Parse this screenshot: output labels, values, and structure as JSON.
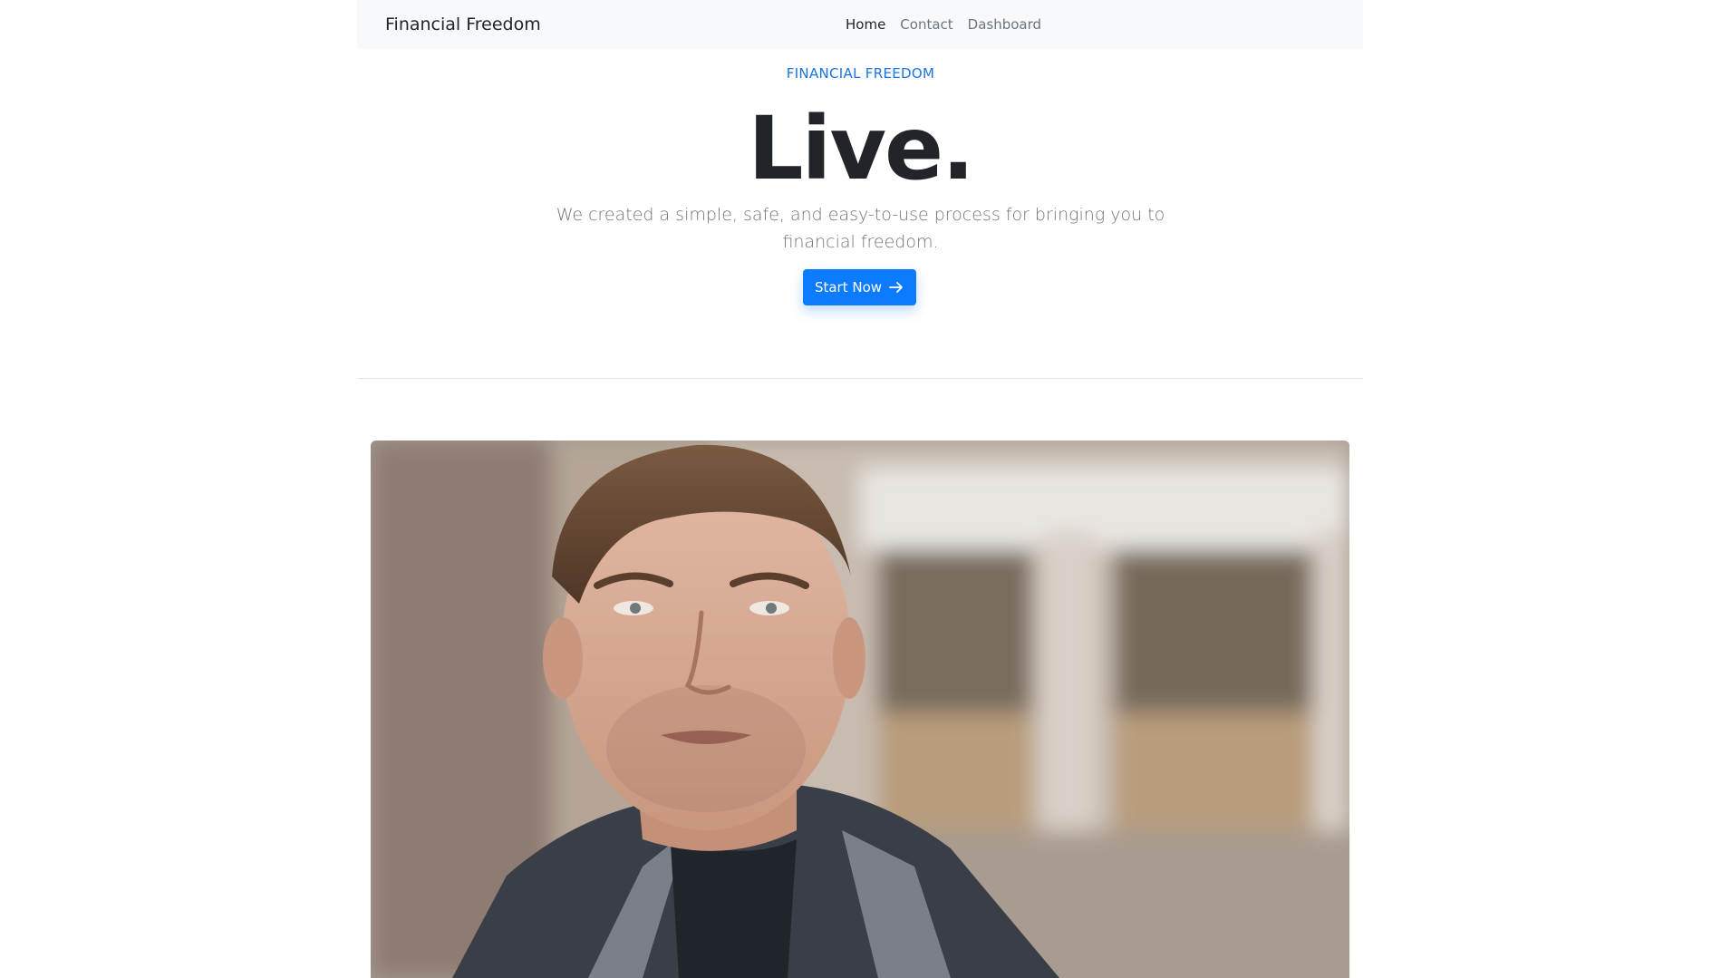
{
  "navbar": {
    "brand": "Financial Freedom",
    "links": [
      {
        "label": "Home",
        "active": true
      },
      {
        "label": "Contact",
        "active": false
      },
      {
        "label": "Dashboard",
        "active": false
      }
    ]
  },
  "hero": {
    "eyebrow": "FINANCIAL FREEDOM",
    "title": "Live.",
    "subtitle": "We created a simple, safe, and easy-to-use process for bringing you to financial freedom.",
    "cta_label": "Start Now",
    "cta_icon": "arrow-right-icon"
  },
  "media": {
    "icon": "video-frame-man-talking"
  },
  "colors": {
    "accent": "#0d7bff",
    "eyebrow": "#1a73e8",
    "navbar_bg": "#f8f9fa",
    "muted_text": "#6c757d"
  }
}
